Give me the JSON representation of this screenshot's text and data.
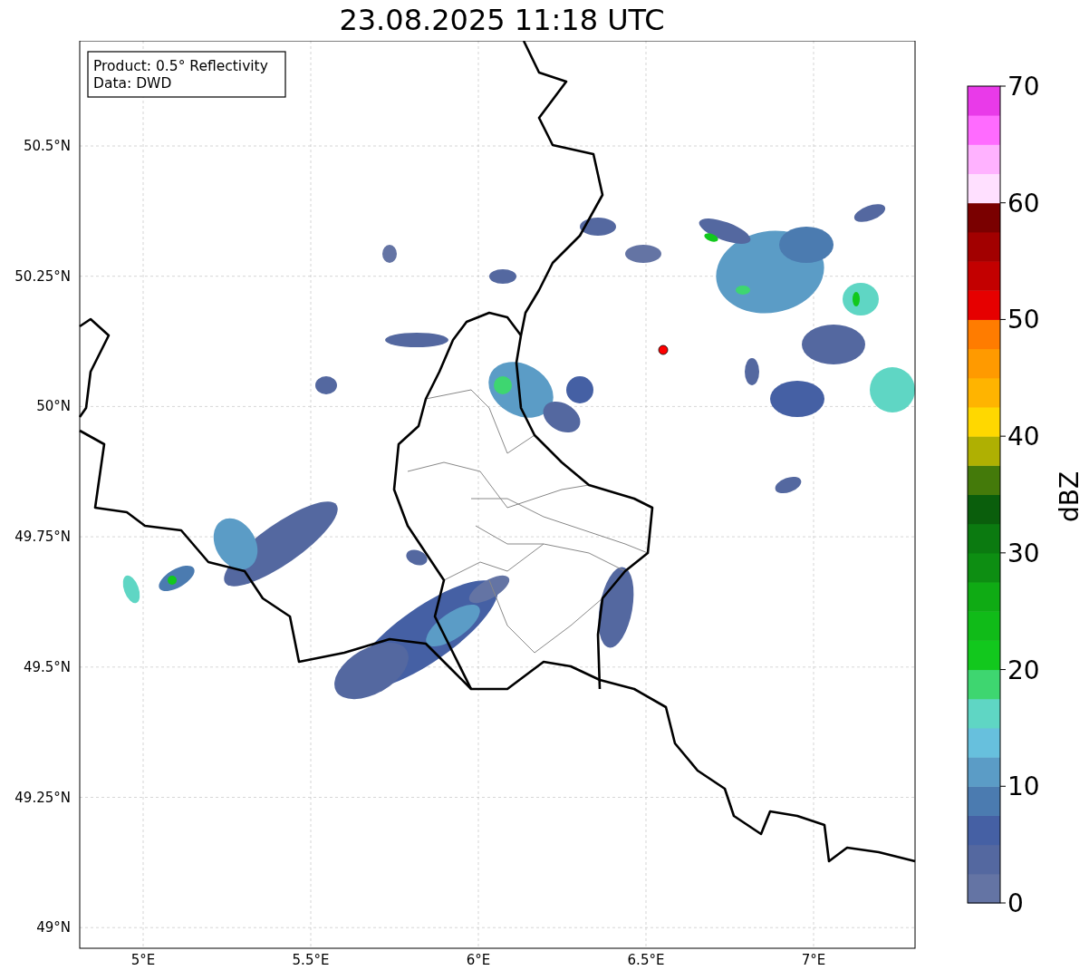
{
  "title": "23.08.2025 11:18 UTC",
  "legend": [
    "Product: 0.5° Reflectivity",
    "Data: DWD"
  ],
  "map": {
    "x_ticks": [
      "5°E",
      "5.5°E",
      "6°E",
      "6.5°E",
      "7°E"
    ],
    "y_ticks": [
      "50.5°N",
      "50.25°N",
      "50°N",
      "49.75°N",
      "49.5°N",
      "49.25°N",
      "49°N"
    ]
  },
  "colorbar": {
    "label": "dBZ",
    "ticks": [
      "70",
      "60",
      "50",
      "40",
      "30",
      "20",
      "10",
      "0"
    ],
    "segments": [
      {
        "color": "#6474a4"
      },
      {
        "color": "#5468a0"
      },
      {
        "color": "#4560a4"
      },
      {
        "color": "#4b7bb0"
      },
      {
        "color": "#5b9cc6"
      },
      {
        "color": "#67c0dd"
      },
      {
        "color": "#5fd6c4"
      },
      {
        "color": "#3ed670"
      },
      {
        "color": "#12c81d"
      },
      {
        "color": "#10bb18"
      },
      {
        "color": "#0fab14"
      },
      {
        "color": "#0d8e12"
      },
      {
        "color": "#0b7a10"
      },
      {
        "color": "#0a5e0c"
      },
      {
        "color": "#447a0a"
      },
      {
        "color": "#afb002"
      },
      {
        "color": "#ffd800"
      },
      {
        "color": "#ffb400"
      },
      {
        "color": "#ff9a00"
      },
      {
        "color": "#ff7c00"
      },
      {
        "color": "#e60000"
      },
      {
        "color": "#c30000"
      },
      {
        "color": "#a20000"
      },
      {
        "color": "#7a0000"
      },
      {
        "color": "#ffe0ff"
      },
      {
        "color": "#ffb2ff"
      },
      {
        "color": "#ff6bff"
      },
      {
        "color": "#e93ae9"
      }
    ]
  }
}
